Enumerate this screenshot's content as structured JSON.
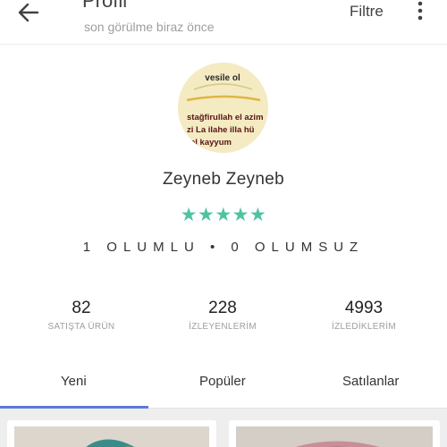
{
  "header": {
    "title": "Profil",
    "subtitle": "son görülme biraz önce",
    "filter_label": "Filtre"
  },
  "avatar": {
    "lines": [
      "vesile ol",
      "stağfirullah el azim",
      "zi La ilahe illa hü",
      "el kayyum"
    ]
  },
  "profile": {
    "name": "Zeyneb Zeyneb",
    "stars": "★★★★★",
    "rating_text": "1 OLUMLU • 0 OLUMSUZ"
  },
  "stats": [
    {
      "value": "82",
      "label": "SATIŞTA ÜRÜN"
    },
    {
      "value": "228",
      "label": "İZLEYENLERİM"
    },
    {
      "value": "4993",
      "label": "İZLEDİKLERİM"
    }
  ],
  "tabs": [
    {
      "label": "Yeni",
      "active": true
    },
    {
      "label": "Popüler",
      "active": false
    },
    {
      "label": "Satılanlar",
      "active": false
    }
  ],
  "colors": {
    "accent": "#5c7bd6",
    "stars": "#4ec3a1"
  }
}
